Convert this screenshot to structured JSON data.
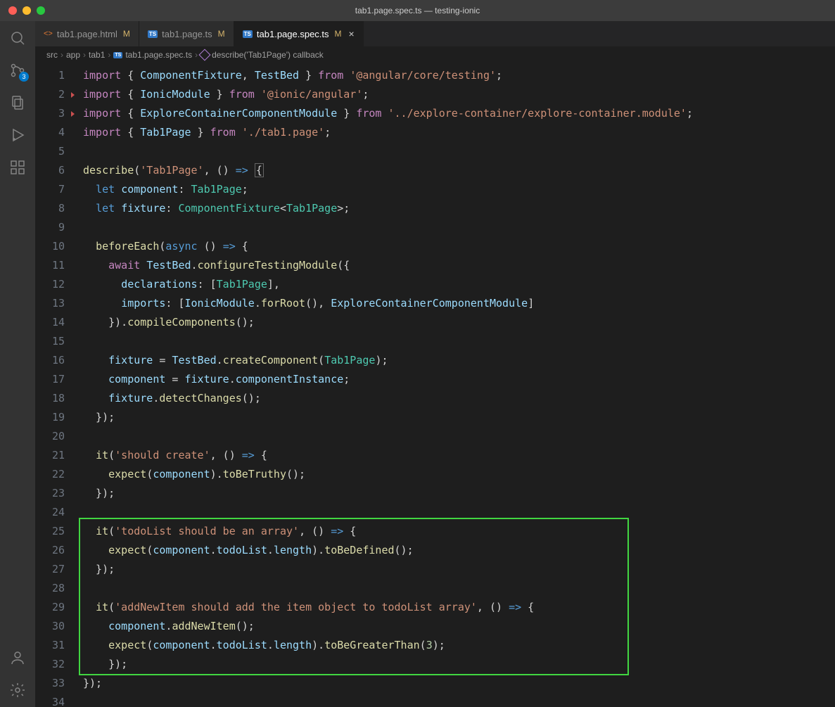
{
  "window": {
    "title": "tab1.page.spec.ts — testing-ionic"
  },
  "activity": {
    "scm_badge": "3"
  },
  "tabs": [
    {
      "icon": "html",
      "label": "tab1.page.html",
      "modified": "M",
      "active": false,
      "close": false
    },
    {
      "icon": "ts",
      "label": "tab1.page.ts",
      "modified": "M",
      "active": false,
      "close": false
    },
    {
      "icon": "ts",
      "label": "tab1.page.spec.ts",
      "modified": "M",
      "active": true,
      "close": true
    }
  ],
  "breadcrumbs": {
    "parts": [
      "src",
      "app",
      "tab1",
      "tab1.page.spec.ts",
      "describe('Tab1Page') callback"
    ]
  },
  "code": {
    "highlight_line": 23,
    "markers": [
      2,
      3
    ],
    "lines": [
      {
        "n": 1,
        "tokens": [
          [
            "kw",
            "import"
          ],
          [
            "punc",
            " { "
          ],
          [
            "var",
            "ComponentFixture"
          ],
          [
            "punc",
            ", "
          ],
          [
            "var",
            "TestBed"
          ],
          [
            "punc",
            " } "
          ],
          [
            "kw",
            "from"
          ],
          [
            "punc",
            " "
          ],
          [
            "str",
            "'@angular/core/testing'"
          ],
          [
            "punc",
            ";"
          ]
        ]
      },
      {
        "n": 2,
        "tokens": [
          [
            "kw",
            "import"
          ],
          [
            "punc",
            " { "
          ],
          [
            "var",
            "IonicModule"
          ],
          [
            "punc",
            " } "
          ],
          [
            "kw",
            "from"
          ],
          [
            "punc",
            " "
          ],
          [
            "str",
            "'@ionic/angular'"
          ],
          [
            "punc",
            ";"
          ]
        ]
      },
      {
        "n": 3,
        "tokens": [
          [
            "kw",
            "import"
          ],
          [
            "punc",
            " { "
          ],
          [
            "var",
            "ExploreContainerComponentModule"
          ],
          [
            "punc",
            " } "
          ],
          [
            "kw",
            "from"
          ],
          [
            "punc",
            " "
          ],
          [
            "str",
            "'../explore-container/explore-container.module'"
          ],
          [
            "punc",
            ";"
          ]
        ]
      },
      {
        "n": 4,
        "tokens": [
          [
            "kw",
            "import"
          ],
          [
            "punc",
            " { "
          ],
          [
            "var",
            "Tab1Page"
          ],
          [
            "punc",
            " } "
          ],
          [
            "kw",
            "from"
          ],
          [
            "punc",
            " "
          ],
          [
            "str",
            "'./tab1.page'"
          ],
          [
            "punc",
            ";"
          ]
        ]
      },
      {
        "n": 5,
        "tokens": []
      },
      {
        "n": 6,
        "tokens": [
          [
            "fn",
            "describe"
          ],
          [
            "punc",
            "("
          ],
          [
            "str",
            "'Tab1Page'"
          ],
          [
            "punc",
            ", () "
          ],
          [
            "decl",
            "=>"
          ],
          [
            "punc",
            " "
          ],
          [
            "bracket",
            "{"
          ]
        ]
      },
      {
        "n": 7,
        "tokens": [
          [
            "punc",
            "  "
          ],
          [
            "decl",
            "let"
          ],
          [
            "punc",
            " "
          ],
          [
            "var",
            "component"
          ],
          [
            "punc",
            ": "
          ],
          [
            "type",
            "Tab1Page"
          ],
          [
            "punc",
            ";"
          ]
        ]
      },
      {
        "n": 8,
        "tokens": [
          [
            "punc",
            "  "
          ],
          [
            "decl",
            "let"
          ],
          [
            "punc",
            " "
          ],
          [
            "var",
            "fixture"
          ],
          [
            "punc",
            ": "
          ],
          [
            "type",
            "ComponentFixture"
          ],
          [
            "punc",
            "<"
          ],
          [
            "type",
            "Tab1Page"
          ],
          [
            "punc",
            ">;"
          ]
        ]
      },
      {
        "n": 9,
        "tokens": []
      },
      {
        "n": 10,
        "tokens": [
          [
            "punc",
            "  "
          ],
          [
            "fn",
            "beforeEach"
          ],
          [
            "punc",
            "("
          ],
          [
            "decl",
            "async"
          ],
          [
            "punc",
            " () "
          ],
          [
            "decl",
            "=>"
          ],
          [
            "punc",
            " {"
          ]
        ]
      },
      {
        "n": 11,
        "tokens": [
          [
            "punc",
            "    "
          ],
          [
            "kw",
            "await"
          ],
          [
            "punc",
            " "
          ],
          [
            "var",
            "TestBed"
          ],
          [
            "punc",
            "."
          ],
          [
            "method",
            "configureTestingModule"
          ],
          [
            "punc",
            "({"
          ]
        ]
      },
      {
        "n": 12,
        "tokens": [
          [
            "punc",
            "      "
          ],
          [
            "prop",
            "declarations"
          ],
          [
            "punc",
            ": ["
          ],
          [
            "type",
            "Tab1Page"
          ],
          [
            "punc",
            "],"
          ]
        ]
      },
      {
        "n": 13,
        "tokens": [
          [
            "punc",
            "      "
          ],
          [
            "prop",
            "imports"
          ],
          [
            "punc",
            ": ["
          ],
          [
            "var",
            "IonicModule"
          ],
          [
            "punc",
            "."
          ],
          [
            "method",
            "forRoot"
          ],
          [
            "punc",
            "(), "
          ],
          [
            "var",
            "ExploreContainerComponentModule"
          ],
          [
            "punc",
            "]"
          ]
        ]
      },
      {
        "n": 14,
        "tokens": [
          [
            "punc",
            "    })."
          ],
          [
            "method",
            "compileComponents"
          ],
          [
            "punc",
            "();"
          ]
        ]
      },
      {
        "n": 15,
        "tokens": []
      },
      {
        "n": 16,
        "tokens": [
          [
            "punc",
            "    "
          ],
          [
            "var",
            "fixture"
          ],
          [
            "punc",
            " = "
          ],
          [
            "var",
            "TestBed"
          ],
          [
            "punc",
            "."
          ],
          [
            "method",
            "createComponent"
          ],
          [
            "punc",
            "("
          ],
          [
            "type",
            "Tab1Page"
          ],
          [
            "punc",
            ");"
          ]
        ]
      },
      {
        "n": 17,
        "tokens": [
          [
            "punc",
            "    "
          ],
          [
            "var",
            "component"
          ],
          [
            "punc",
            " = "
          ],
          [
            "var",
            "fixture"
          ],
          [
            "punc",
            "."
          ],
          [
            "prop",
            "componentInstance"
          ],
          [
            "punc",
            ";"
          ]
        ]
      },
      {
        "n": 18,
        "tokens": [
          [
            "punc",
            "    "
          ],
          [
            "var",
            "fixture"
          ],
          [
            "punc",
            "."
          ],
          [
            "method",
            "detectChanges"
          ],
          [
            "punc",
            "();"
          ]
        ]
      },
      {
        "n": 19,
        "tokens": [
          [
            "punc",
            "  });"
          ]
        ]
      },
      {
        "n": 20,
        "tokens": []
      },
      {
        "n": 21,
        "tokens": [
          [
            "punc",
            "  "
          ],
          [
            "fn",
            "it"
          ],
          [
            "punc",
            "("
          ],
          [
            "str",
            "'should create'"
          ],
          [
            "punc",
            ", () "
          ],
          [
            "decl",
            "=>"
          ],
          [
            "punc",
            " {"
          ]
        ]
      },
      {
        "n": 22,
        "tokens": [
          [
            "punc",
            "    "
          ],
          [
            "fn",
            "expect"
          ],
          [
            "punc",
            "("
          ],
          [
            "var",
            "component"
          ],
          [
            "punc",
            ")."
          ],
          [
            "method",
            "toBeTruthy"
          ],
          [
            "punc",
            "();"
          ]
        ]
      },
      {
        "n": 23,
        "tokens": [
          [
            "punc",
            "  });"
          ]
        ]
      },
      {
        "n": 24,
        "tokens": []
      },
      {
        "n": 25,
        "tokens": [
          [
            "punc",
            "  "
          ],
          [
            "fn",
            "it"
          ],
          [
            "punc",
            "("
          ],
          [
            "str",
            "'todoList should be an array'"
          ],
          [
            "punc",
            ", () "
          ],
          [
            "decl",
            "=>"
          ],
          [
            "punc",
            " {"
          ]
        ]
      },
      {
        "n": 26,
        "tokens": [
          [
            "punc",
            "    "
          ],
          [
            "fn",
            "expect"
          ],
          [
            "punc",
            "("
          ],
          [
            "var",
            "component"
          ],
          [
            "punc",
            "."
          ],
          [
            "prop",
            "todoList"
          ],
          [
            "punc",
            "."
          ],
          [
            "prop",
            "length"
          ],
          [
            "punc",
            ")."
          ],
          [
            "method",
            "toBeDefined"
          ],
          [
            "punc",
            "();"
          ]
        ]
      },
      {
        "n": 27,
        "tokens": [
          [
            "punc",
            "  });"
          ]
        ]
      },
      {
        "n": 28,
        "tokens": []
      },
      {
        "n": 29,
        "tokens": [
          [
            "punc",
            "  "
          ],
          [
            "fn",
            "it"
          ],
          [
            "punc",
            "("
          ],
          [
            "str",
            "'addNewItem should add the item object to todoList array'"
          ],
          [
            "punc",
            ", () "
          ],
          [
            "decl",
            "=>"
          ],
          [
            "punc",
            " {"
          ]
        ]
      },
      {
        "n": 30,
        "tokens": [
          [
            "punc",
            "    "
          ],
          [
            "var",
            "component"
          ],
          [
            "punc",
            "."
          ],
          [
            "method",
            "addNewItem"
          ],
          [
            "punc",
            "();"
          ]
        ]
      },
      {
        "n": 31,
        "tokens": [
          [
            "punc",
            "    "
          ],
          [
            "fn",
            "expect"
          ],
          [
            "punc",
            "("
          ],
          [
            "var",
            "component"
          ],
          [
            "punc",
            "."
          ],
          [
            "prop",
            "todoList"
          ],
          [
            "punc",
            "."
          ],
          [
            "prop",
            "length"
          ],
          [
            "punc",
            ")."
          ],
          [
            "method",
            "toBeGreaterThan"
          ],
          [
            "punc",
            "("
          ],
          [
            "num",
            "3"
          ],
          [
            "punc",
            ");"
          ]
        ]
      },
      {
        "n": 32,
        "tokens": [
          [
            "punc",
            "    });"
          ]
        ]
      },
      {
        "n": 33,
        "tokens": [
          [
            "punc",
            "});"
          ]
        ]
      },
      {
        "n": 34,
        "tokens": []
      }
    ],
    "green_box": {
      "start": 25,
      "end": 32
    }
  }
}
